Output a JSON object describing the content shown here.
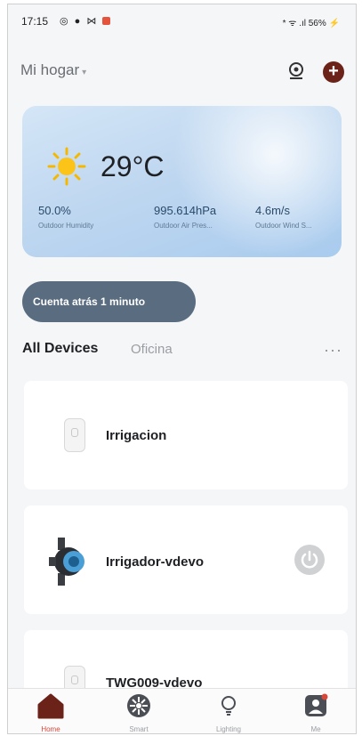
{
  "status_bar": {
    "time": "17:15",
    "right": "* ᯤ .ıl 56% ⚡"
  },
  "header": {
    "home_name": "Mi hogar",
    "caret": "▾"
  },
  "weather": {
    "temperature": "29°C",
    "humidity": {
      "value": "50.0%",
      "label": "Outdoor Humidity"
    },
    "pressure": {
      "value": "995.614hPa",
      "label": "Outdoor Air Pres..."
    },
    "wind": {
      "value": "4.6m/s",
      "label": "Outdoor Wind S..."
    }
  },
  "countdown": {
    "label": "Cuenta atrás 1 minuto"
  },
  "tabs": {
    "all": "All Devices",
    "oficina": "Oficina",
    "more": "···"
  },
  "devices": [
    {
      "name": "Irrigacion"
    },
    {
      "name": "Irrigador-vdevo"
    },
    {
      "name": "TWG009-vdevo"
    }
  ],
  "bottom_nav": [
    {
      "label": "Home",
      "icon": "home-icon"
    },
    {
      "label": "Smart",
      "icon": "smart-icon"
    },
    {
      "label": "Lighting",
      "icon": "bulb-icon"
    },
    {
      "label": "Me",
      "icon": "profile-icon"
    }
  ],
  "colors": {
    "accent": "#d6483c",
    "add_button": "#6b2218",
    "countdown_bg": "#5a6c80"
  }
}
